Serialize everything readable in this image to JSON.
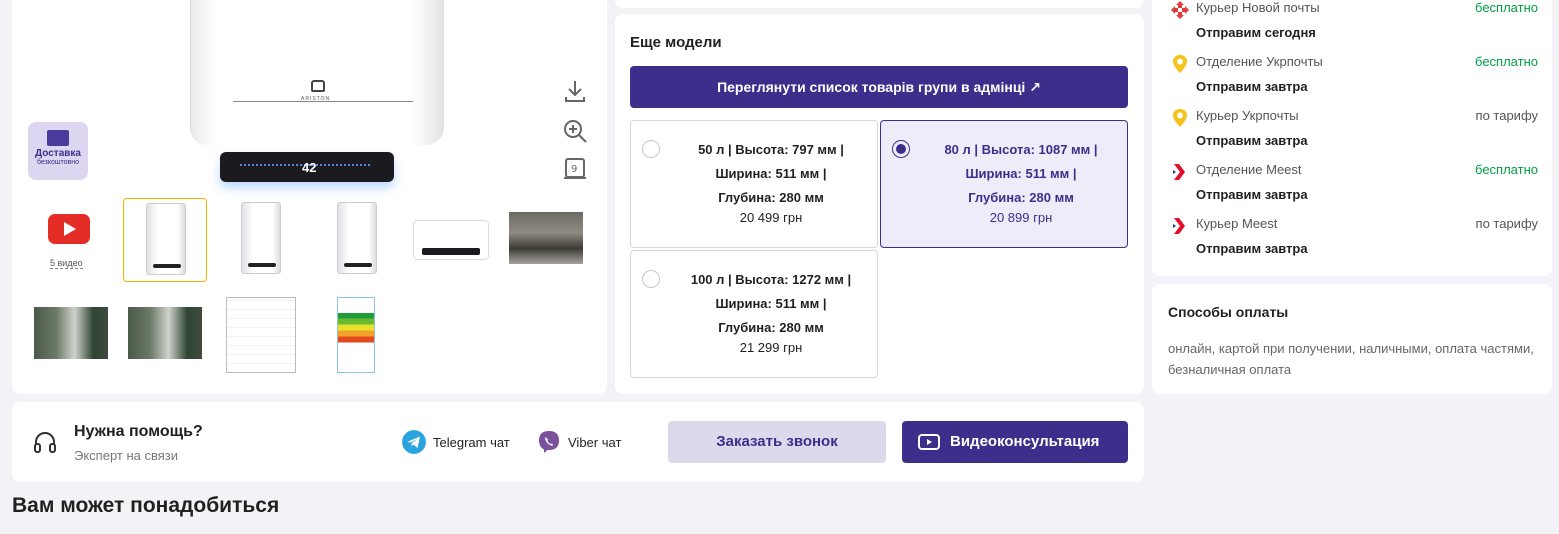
{
  "gallery": {
    "brand": "ARISTON",
    "display_value": "42",
    "delivery_badge": {
      "line1": "Доставка",
      "line2": "безкоштовно"
    },
    "video_count": "5 видео",
    "icons": [
      "download-icon",
      "zoom-in-icon",
      "360-view-icon"
    ]
  },
  "models": {
    "title": "Еще модели",
    "admin_button": "Переглянути список товарів групи в адмінці ↗",
    "options": [
      {
        "l1": "50 л | Высота: 797 мм |",
        "l2": "Ширина: 511 мм |",
        "l3": "Глубина: 280 мм",
        "price": "20 499 грн",
        "selected": false
      },
      {
        "l1": "80 л | Высота: 1087 мм |",
        "l2": "Ширина: 511 мм |",
        "l3": "Глубина: 280 мм",
        "price": "20 899 грн",
        "selected": true
      },
      {
        "l1": "100 л | Высота: 1272 мм |",
        "l2": "Ширина: 511 мм |",
        "l3": "Глубина: 280 мм",
        "price": "21 299 грн",
        "selected": false
      }
    ]
  },
  "delivery": {
    "rows": [
      {
        "name": "Курьер Новой почты",
        "price": "бесплатно",
        "when": "Отправим сегодня",
        "icon": "nova-poshta-icon"
      },
      {
        "name": "Отделение Укрпочты",
        "price": "бесплатно",
        "when": "Отправим завтра",
        "icon": "ukrposhta-icon"
      },
      {
        "name": "Курьер Укрпочты",
        "price": "по тарифу",
        "when": "Отправим завтра",
        "icon": "ukrposhta-icon"
      },
      {
        "name": "Отделение Meest",
        "price": "бесплатно",
        "when": "Отправим завтра",
        "icon": "meest-icon"
      },
      {
        "name": "Курьер Meest",
        "price": "по тарифу",
        "when": "Отправим завтра",
        "icon": "meest-icon"
      }
    ]
  },
  "payment": {
    "title": "Способы оплаты",
    "text": "онлайн, картой при получении, наличными, оплата частями, безналичная оплата"
  },
  "help": {
    "title": "Нужна помощь?",
    "subtitle": "Эксперт на связи",
    "telegram": "Telegram чат",
    "viber": "Viber чат",
    "call_button": "Заказать звонок",
    "video_button": "Видеоконсультация"
  },
  "section_title": "Вам может понадобиться",
  "colors": {
    "accent": "#3e2e8c",
    "free": "#00a046",
    "background": "#f3f3f7"
  }
}
